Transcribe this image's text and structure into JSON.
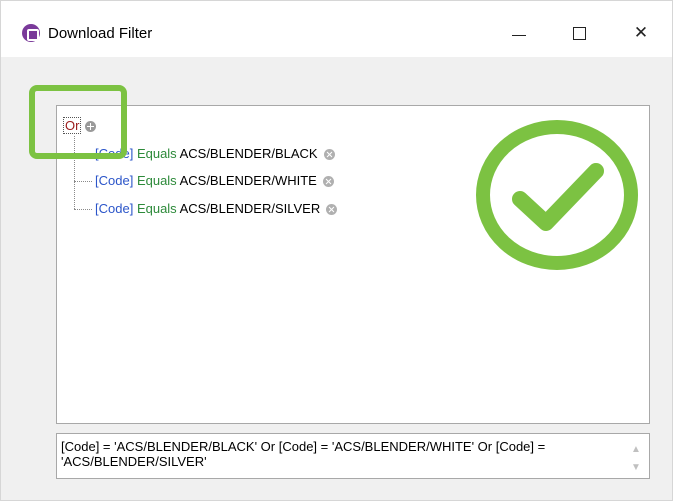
{
  "window": {
    "title": "Download Filter",
    "close_glyph": "✕"
  },
  "filter_tree": {
    "root_label": "Or",
    "conditions": [
      {
        "field": "[Code]",
        "operator": "Equals",
        "value": "ACS/BLENDER/BLACK"
      },
      {
        "field": "[Code]",
        "operator": "Equals",
        "value": "ACS/BLENDER/WHITE"
      },
      {
        "field": "[Code]",
        "operator": "Equals",
        "value": "ACS/BLENDER/SILVER"
      }
    ]
  },
  "expression": {
    "text": "[Code] = 'ACS/BLENDER/BLACK' Or [Code] = 'ACS/BLENDER/WHITE' Or [Code] = 'ACS/BLENDER/SILVER'"
  },
  "icons": {
    "app": "app-logo-icon",
    "add": "add-condition-icon",
    "remove": "remove-condition-icon",
    "check": "checkmark-circle-icon"
  },
  "colors": {
    "or_label": "#9b1c1c",
    "field": "#2b55c9",
    "operator": "#2d8a3a",
    "highlight": "#7cc242"
  }
}
